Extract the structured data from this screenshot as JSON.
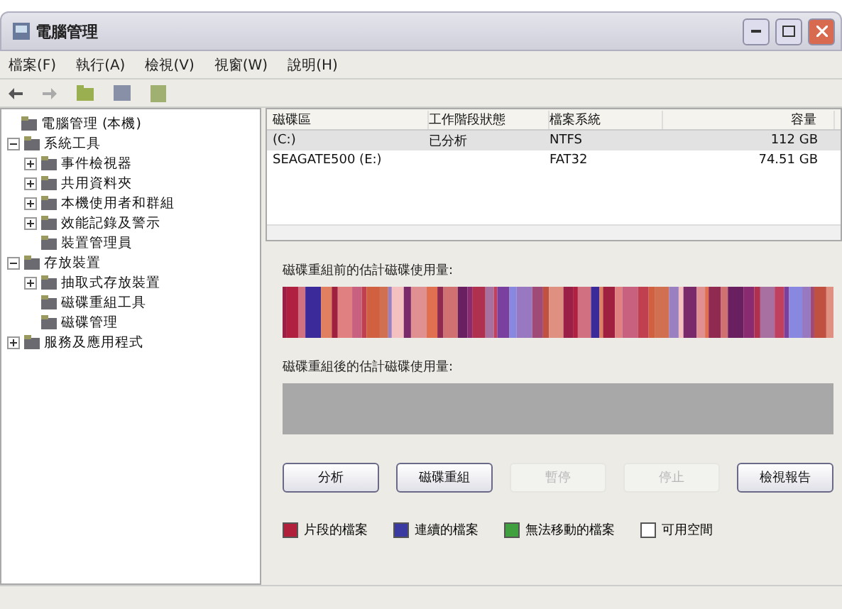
{
  "window": {
    "title": "電腦管理"
  },
  "menu": [
    "檔案(F)",
    "執行(A)",
    "檢視(V)",
    "視窗(W)",
    "說明(H)"
  ],
  "tree": {
    "label": "電腦管理 (本機)",
    "children": [
      {
        "label": "系統工具",
        "expanded": true,
        "children": [
          {
            "label": "事件檢視器",
            "expanded": false
          },
          {
            "label": "共用資料夾",
            "expanded": false
          },
          {
            "label": "本機使用者和群組",
            "expanded": false
          },
          {
            "label": "效能記錄及警示",
            "expanded": false
          },
          {
            "label": "裝置管理員"
          }
        ]
      },
      {
        "label": "存放裝置",
        "expanded": true,
        "children": [
          {
            "label": "抽取式存放裝置",
            "expanded": false
          },
          {
            "label": "磁碟重組工具"
          },
          {
            "label": "磁碟管理"
          }
        ]
      },
      {
        "label": "服務及應用程式",
        "expanded": false
      }
    ]
  },
  "volumes": {
    "columns": [
      "磁碟區",
      "工作階段狀態",
      "檔案系統",
      "容量"
    ],
    "rows": [
      {
        "cells": [
          "(C:)",
          "已分析",
          "NTFS",
          "112 GB"
        ],
        "selected": true
      },
      {
        "cells": [
          "SEAGATE500 (E:)",
          "",
          "FAT32",
          "74.51 GB"
        ],
        "selected": false
      }
    ]
  },
  "before_label": "磁碟重組前的估計磁碟使用量:",
  "after_label": "磁碟重組後的估計磁碟使用量:",
  "buttons": [
    {
      "label": "分析",
      "disabled": false
    },
    {
      "label": "磁碟重組",
      "disabled": false
    },
    {
      "label": "暫停",
      "disabled": true
    },
    {
      "label": "停止",
      "disabled": true
    },
    {
      "label": "檢視報告",
      "disabled": false
    }
  ],
  "legend": [
    {
      "label": "片段的檔案",
      "color": "#b0203a"
    },
    {
      "label": "連續的檔案",
      "color": "#3a3aa0"
    },
    {
      "label": "無法移動的檔案",
      "color": "#40a040"
    },
    {
      "label": "可用空間",
      "color": "#ffffff"
    }
  ]
}
